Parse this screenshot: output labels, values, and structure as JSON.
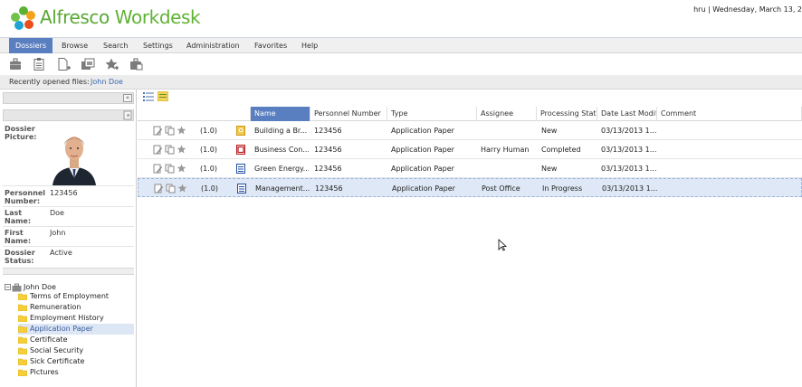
{
  "header": {
    "brand_part1": "Alfresco",
    "brand_part2": " Workdesk",
    "user_info": "hru | Wednesday, March 13, 2"
  },
  "menu": [
    {
      "label": "Dossiers",
      "active": true
    },
    {
      "label": "Browse"
    },
    {
      "label": "Search"
    },
    {
      "label": "Settings"
    },
    {
      "label": "Administration"
    },
    {
      "label": "Favorites"
    },
    {
      "label": "Help"
    }
  ],
  "toolbar": {
    "icons": [
      "briefcase-icon",
      "clipboard-icon",
      "new-document-icon",
      "copy-dossier-icon",
      "favorite-star-icon",
      "dossier-add-icon"
    ]
  },
  "recent": {
    "label": "Recently opened files:",
    "link": "John Doe"
  },
  "left": {
    "collapse_icon": "«",
    "expand_icon": "«",
    "props": {
      "dossier_picture_label": "Dossier\nPicture:",
      "personnel_number_label": "Personnel\nNumber:",
      "personnel_number_value": "123456",
      "last_name_label": "Last\nName:",
      "last_name_value": "Doe",
      "first_name_label": "First\nName:",
      "first_name_value": "John",
      "status_label": "Dossier\nStatus:",
      "status_value": "Active"
    },
    "tree": {
      "root": "John Doe",
      "items": [
        {
          "label": "Terms of Employment"
        },
        {
          "label": "Remuneration"
        },
        {
          "label": "Employment History"
        },
        {
          "label": "Application Paper",
          "selected": true
        },
        {
          "label": "Certificate"
        },
        {
          "label": "Social Security"
        },
        {
          "label": "Sick Certificate"
        },
        {
          "label": "Pictures"
        }
      ]
    }
  },
  "grid": {
    "columns": {
      "name": "Name",
      "personnel_number": "Personnel Number",
      "type": "Type",
      "assignee": "Assignee",
      "processing_status": "Processing Stat...",
      "date_modified": "Date Last Modifi...",
      "comment": "Comment"
    },
    "rows": [
      {
        "version": "(1.0)",
        "doctype": "image",
        "name": "Building a Br...",
        "personnel_number": "123456",
        "type": "Application Paper",
        "assignee": "",
        "status": "New",
        "date": "03/13/2013 1...",
        "comment": ""
      },
      {
        "version": "(1.0)",
        "doctype": "pdf",
        "name": "Business Con...",
        "personnel_number": "123456",
        "type": "Application Paper",
        "assignee": "Harry Human",
        "status": "Completed",
        "date": "03/13/2013 1...",
        "comment": ""
      },
      {
        "version": "(1.0)",
        "doctype": "word",
        "name": "Green Energy...",
        "personnel_number": "123456",
        "type": "Application Paper",
        "assignee": "",
        "status": "New",
        "date": "03/13/2013 1...",
        "comment": ""
      },
      {
        "version": "(1.0)",
        "doctype": "word",
        "name": "Management...",
        "personnel_number": "123456",
        "type": "Application Paper",
        "assignee": "Post Office",
        "status": "In Progress",
        "date": "03/13/2013 1...",
        "comment": "",
        "selected": true
      }
    ]
  },
  "colors": {
    "accent": "#5a7fc1",
    "brand_green": "#5aa733",
    "link": "#3a67b1"
  }
}
